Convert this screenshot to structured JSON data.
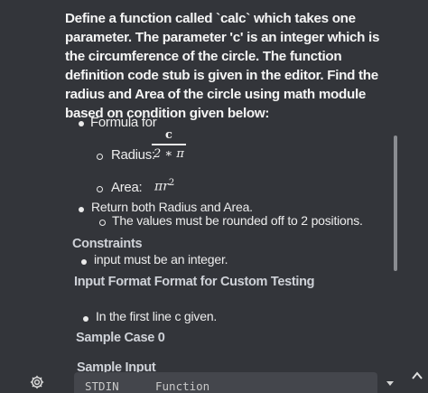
{
  "problem": {
    "paragraph": "Define a function called `calc` which takes one parameter. The parameter 'c' is an integer which is the circumference of the circle. The function definition code stub is given in the editor. Find the radius and Area of the circle using math module based on condition given below:",
    "formula_label": "Formula for",
    "radius_label": "Radius:",
    "radius_numerator": "c",
    "radius_denominator": "2 ∗ π",
    "area_label": "Area:",
    "area_formula": "πr",
    "area_exponent": "2",
    "return_text": "Return both Radius and Area.",
    "rounding_text": "The values must be rounded off to 2 positions."
  },
  "constraints": {
    "heading": "Constraints",
    "item": "input must be an integer."
  },
  "input_format": {
    "heading": "Input Format Format for Custom Testing",
    "item": "In the first line c given."
  },
  "sample_case": {
    "heading": "Sample Case 0"
  },
  "sample_input": {
    "heading": "Sample Input",
    "col_stdin": "STDIN",
    "col_function": "Function"
  },
  "icons": [
    "gear-icon",
    "chevron-up-icon",
    "caret-down-icon"
  ]
}
